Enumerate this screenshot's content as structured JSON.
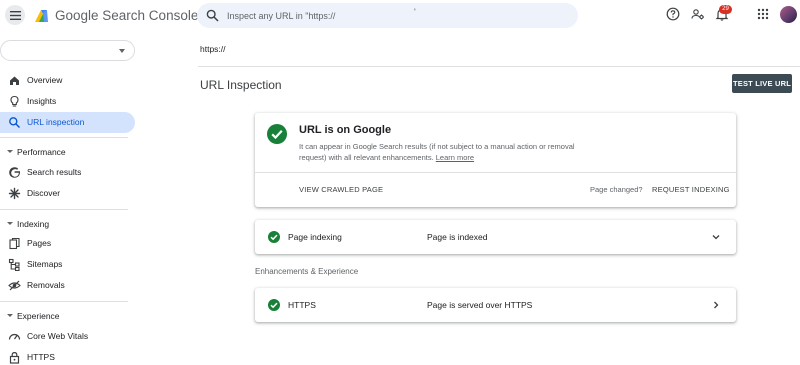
{
  "header": {
    "app_title": "Google Search Console",
    "search_placeholder": "Inspect any URL in \"https://",
    "search_suffix": "'",
    "notification_count": "29"
  },
  "sidebar": {
    "items_top": [
      {
        "label": "Overview",
        "icon": "home-icon"
      },
      {
        "label": "Insights",
        "icon": "lightbulb-icon"
      },
      {
        "label": "URL inspection",
        "icon": "search-icon",
        "active": true
      }
    ],
    "sections": [
      {
        "title": "Performance",
        "items": [
          {
            "label": "Search results",
            "icon": "google-g-icon"
          },
          {
            "label": "Discover",
            "icon": "discover-icon"
          }
        ]
      },
      {
        "title": "Indexing",
        "items": [
          {
            "label": "Pages",
            "icon": "pages-icon"
          },
          {
            "label": "Sitemaps",
            "icon": "sitemap-icon"
          },
          {
            "label": "Removals",
            "icon": "removals-icon"
          }
        ]
      },
      {
        "title": "Experience",
        "items": [
          {
            "label": "Core Web Vitals",
            "icon": "speed-gauge-icon"
          },
          {
            "label": "HTTPS",
            "icon": "lock-icon"
          }
        ]
      }
    ]
  },
  "main": {
    "url": "https://",
    "page_title": "URL Inspection",
    "test_live_label": "TEST LIVE URL",
    "status_card": {
      "title": "URL is on Google",
      "description": "It can appear in Google Search results (if not subject to a manual action or removal request) with all relevant enhancements.",
      "learn_more": "Learn more",
      "view_crawled": "VIEW CRAWLED PAGE",
      "page_changed": "Page changed?",
      "request_indexing": "REQUEST INDEXING"
    },
    "indexing_row": {
      "label": "Page indexing",
      "status": "Page is indexed"
    },
    "enhancements_heading": "Enhancements & Experience",
    "https_row": {
      "label": "HTTPS",
      "status": "Page is served over HTTPS"
    }
  },
  "colors": {
    "success_green": "#188038",
    "active_nav_bg": "#d3e3fd",
    "active_nav_text": "#0b57d0",
    "test_live_bg": "#3c4a54",
    "badge_red": "#d93025"
  }
}
